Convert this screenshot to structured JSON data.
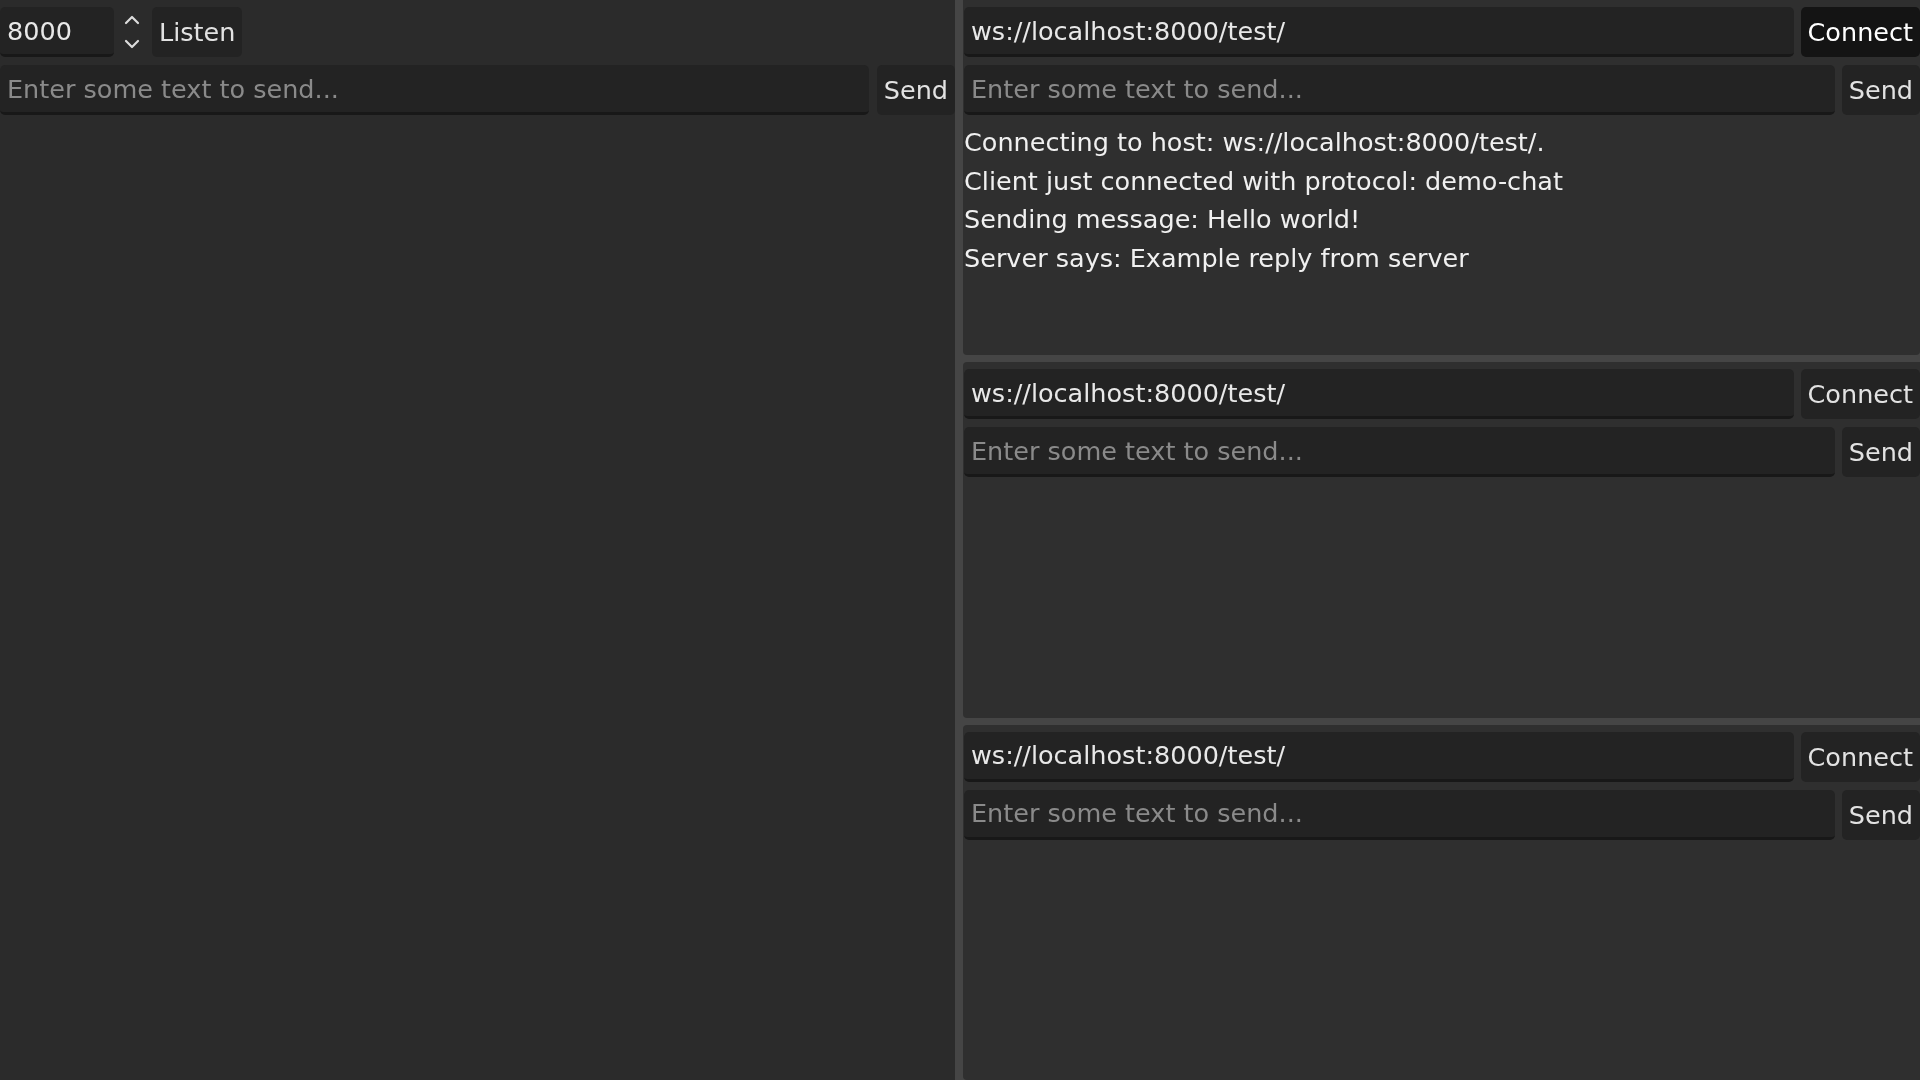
{
  "server": {
    "port": "8000",
    "listen_button": "Listen",
    "message": {
      "placeholder": "Enter some text to send..."
    },
    "send_button": "Send"
  },
  "clients": [
    {
      "url": "ws://localhost:8000/test/",
      "connect_button": {
        "label": "Connect",
        "highlighted": true
      },
      "message": {
        "placeholder": "Enter some text to send..."
      },
      "send_button": "Send",
      "log": [
        "Connecting to host: ws://localhost:8000/test/.",
        "Client just connected with protocol: demo-chat",
        "Sending message: Hello world!",
        "Server says: Example reply from server"
      ]
    },
    {
      "url": "ws://localhost:8000/test/",
      "connect_button": {
        "label": "Connect",
        "highlighted": false
      },
      "message": {
        "placeholder": "Enter some text to send..."
      },
      "send_button": "Send"
    },
    {
      "url": "ws://localhost:8000/test/",
      "connect_button": {
        "label": "Connect",
        "highlighted": false
      },
      "message": {
        "placeholder": "Enter some text to send..."
      },
      "send_button": "Send"
    }
  ]
}
